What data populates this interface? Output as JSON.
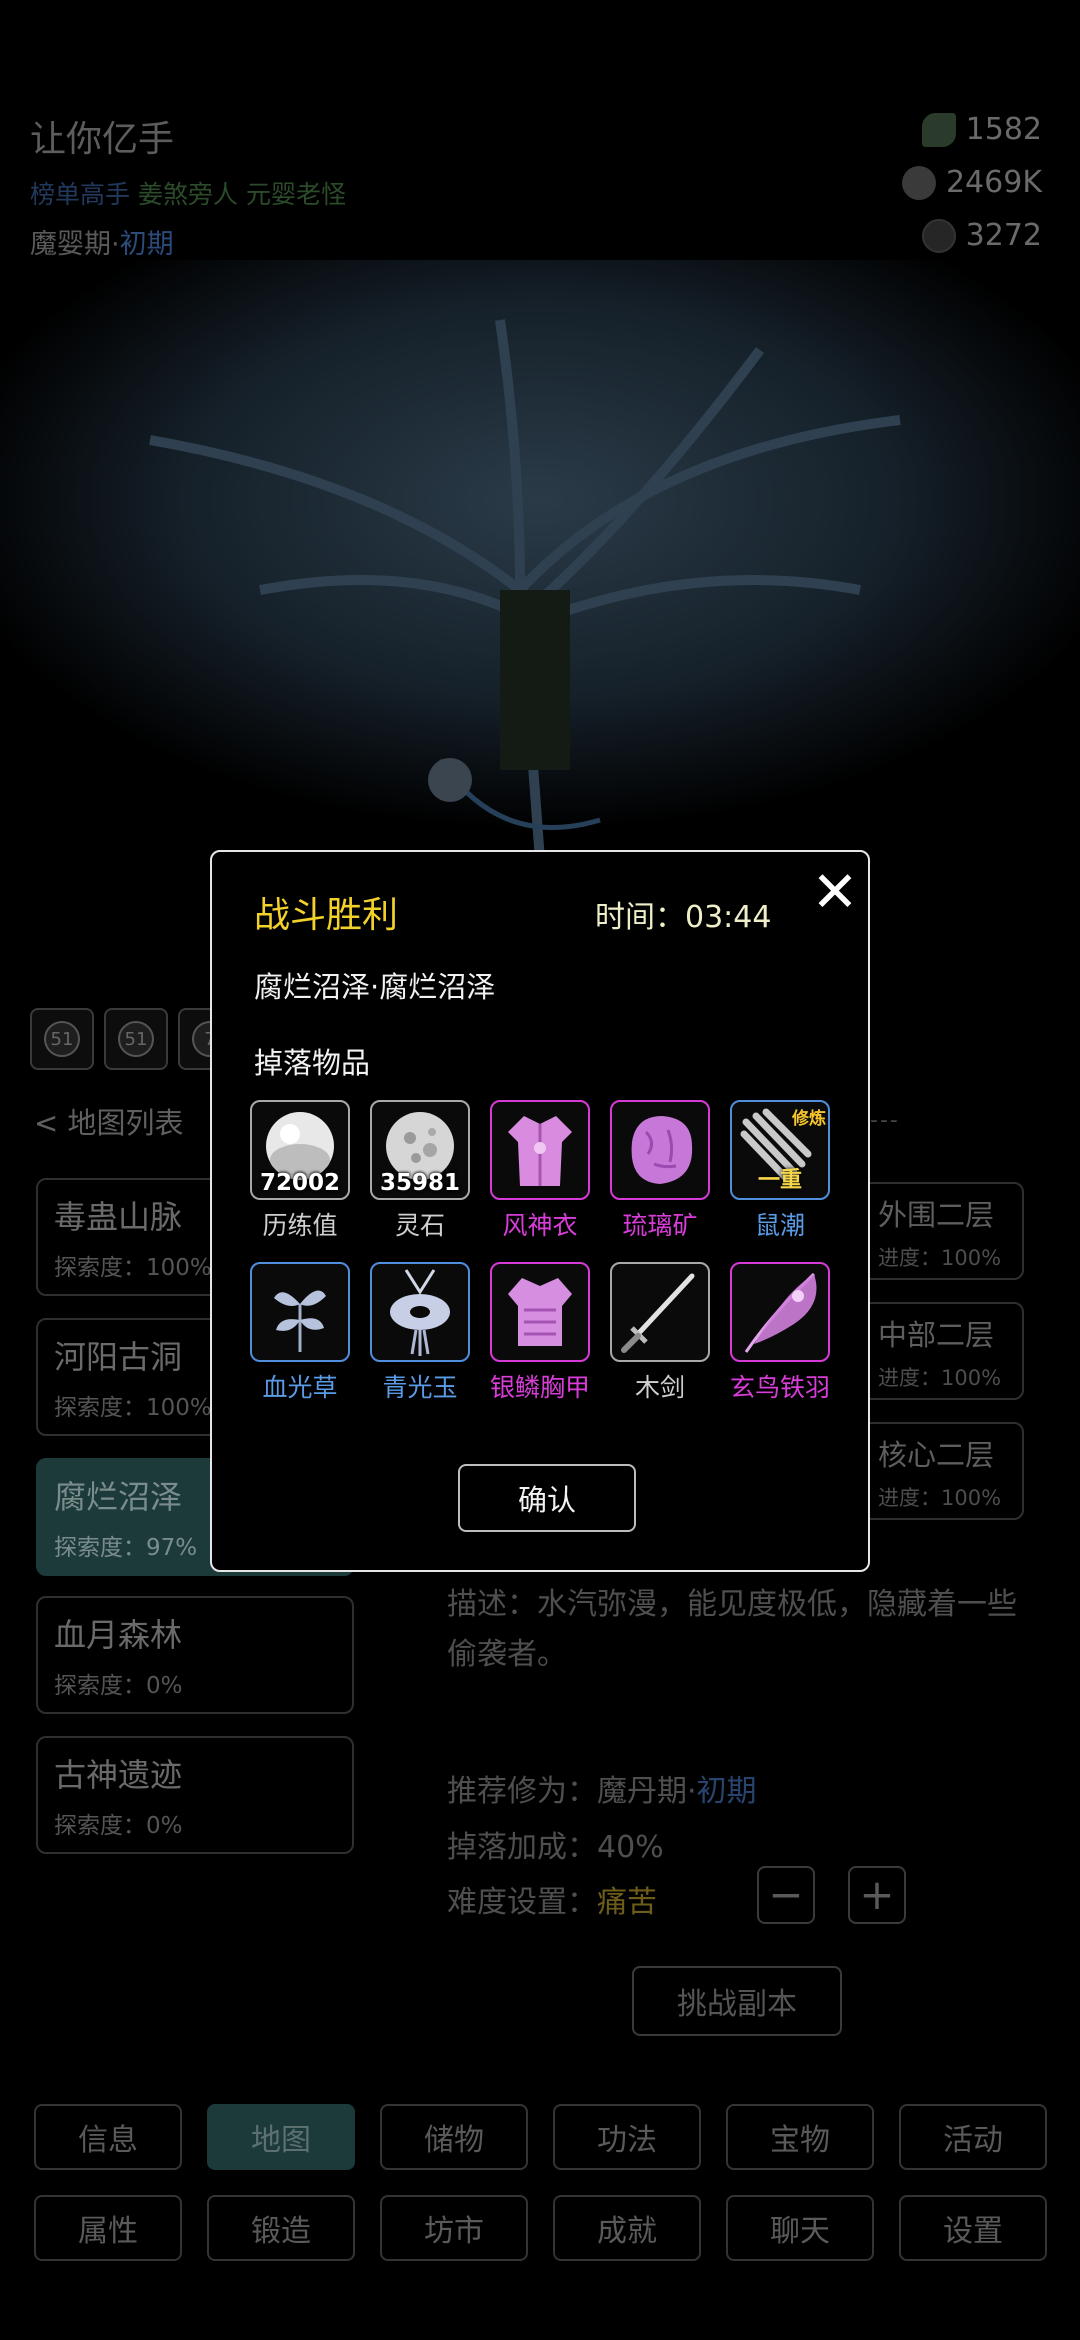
{
  "player": {
    "name": "让你亿手",
    "titles": [
      {
        "text": "榜单高手",
        "color": "#22395e"
      },
      {
        "text": "姜煞旁人",
        "color": "#2b4b2a"
      },
      {
        "text": "元婴老怪",
        "color": "#2b4b2a"
      }
    ],
    "realm_main": "魔婴期·",
    "realm_sub": "初期"
  },
  "resources": {
    "herb": "1582",
    "stone": "2469K",
    "orb": "3272"
  },
  "quick_icons": [
    "51",
    "51",
    "7"
  ],
  "map_list": {
    "back_label": "< 地图列表",
    "maps": [
      {
        "name": "毒蛊山脉",
        "progress": "探索度：100%"
      },
      {
        "name": "河阳古洞",
        "progress": "探索度：100%"
      },
      {
        "name": "腐烂沼泽",
        "progress": "探索度：97%"
      },
      {
        "name": "血月森林",
        "progress": "探索度：0%"
      },
      {
        "name": "古神遗迹",
        "progress": "探索度：0%"
      }
    ]
  },
  "floors": {
    "dash": "---",
    "items": [
      {
        "name": "外围二层",
        "progress": "进度：100%"
      },
      {
        "name": "中部二层",
        "progress": "进度：100%"
      },
      {
        "name": "核心二层",
        "progress": "进度：100%"
      }
    ]
  },
  "detail": {
    "description": "描述：水汽弥漫，能见度极低，隐藏着一些偷袭者。",
    "rec_label": "推荐修为：魔丹期·",
    "rec_value": "初期",
    "bonus": "掉落加成：40%",
    "difficulty_label": "难度设置：",
    "difficulty_value": "痛苦",
    "minus": "−",
    "plus": "+",
    "challenge": "挑战副本"
  },
  "nav": {
    "row1": [
      "信息",
      "地图",
      "储物",
      "功法",
      "宝物",
      "活动"
    ],
    "row2": [
      "属性",
      "锻造",
      "坊市",
      "成就",
      "聊天",
      "设置"
    ],
    "active": "地图"
  },
  "modal": {
    "title": "战斗胜利",
    "time": "时间：03:44",
    "close": "✕",
    "location": "腐烂沼泽·腐烂沼泽",
    "drops_label": "掉落物品",
    "items": [
      {
        "name": "历练值",
        "count": "72002",
        "rarity": "grey",
        "icon": "white-orb-icon"
      },
      {
        "name": "灵石",
        "count": "35981",
        "rarity": "grey",
        "icon": "spirit-stone-icon"
      },
      {
        "name": "风神衣",
        "rarity": "purple",
        "icon": "robe-icon"
      },
      {
        "name": "琉璃矿",
        "rarity": "purple",
        "icon": "ore-icon"
      },
      {
        "name": "鼠潮",
        "tag": "修炼",
        "grade": "一重",
        "rarity": "blue",
        "icon": "scroll-icon"
      },
      {
        "name": "血光草",
        "rarity": "blue",
        "icon": "herb-icon"
      },
      {
        "name": "青光玉",
        "rarity": "blue",
        "icon": "jade-pendant-icon"
      },
      {
        "name": "银鳞胸甲",
        "rarity": "purple",
        "icon": "armor-icon"
      },
      {
        "name": "木剑",
        "rarity": "grey",
        "icon": "sword-icon"
      },
      {
        "name": "玄鸟铁羽",
        "rarity": "purple",
        "icon": "feather-icon"
      }
    ],
    "confirm": "确认"
  },
  "colors": {
    "gold_title": "#f2d12a",
    "purple": "#d93dd9",
    "blue": "#5a9be6",
    "active_tab": "#1d3a3a"
  }
}
